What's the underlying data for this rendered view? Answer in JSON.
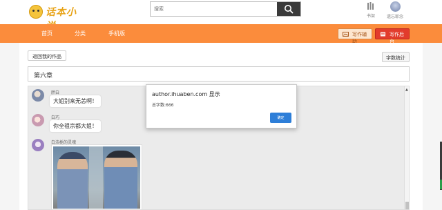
{
  "header": {
    "logo_text": "话本小说",
    "search_placeholder": "搜索",
    "bookshelf_label": "书架",
    "user_label": "遗忘耶念"
  },
  "nav": {
    "items": [
      {
        "label": "首页"
      },
      {
        "label": "分类"
      },
      {
        "label": "手机版"
      }
    ],
    "write_label": "写作辅助",
    "backend_label": "写作后台",
    "colors": {
      "bar": "#fb8c3c",
      "backend_button": "#e23b2c"
    }
  },
  "main": {
    "back_label": "返回我的作品",
    "word_count_label": "字数统计",
    "chapter_title": "第六章"
  },
  "chat": {
    "messages": [
      {
        "name": "胖白",
        "text": "大姐别来无恙啊！"
      },
      {
        "name": "白巧",
        "text": "你全祖宗都大姐！"
      },
      {
        "name": "白浩栀的灵魂",
        "image": "two-police-officers-photo"
      }
    ]
  },
  "dialog": {
    "title": "author.ihuaben.com 显示",
    "message": "总字数:666",
    "ok_label": "确定"
  }
}
